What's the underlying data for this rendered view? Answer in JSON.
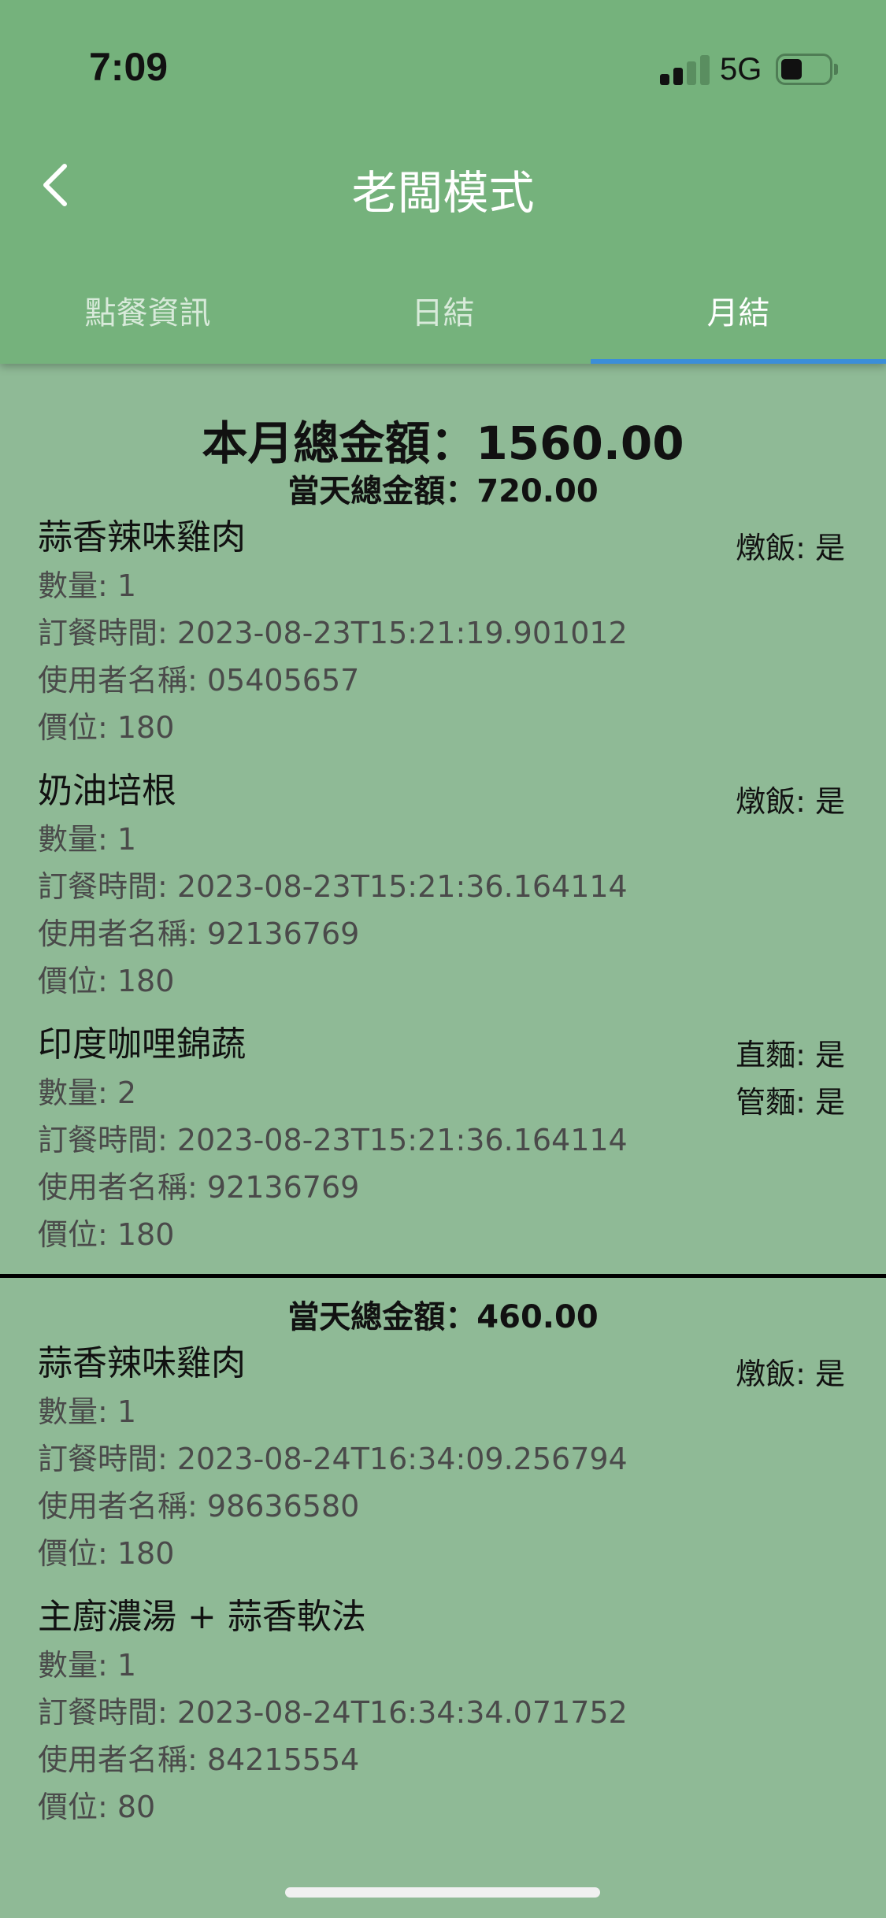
{
  "status_bar": {
    "time": "7:09",
    "network": "5G"
  },
  "header": {
    "title": "老闆模式"
  },
  "tabs": [
    {
      "label": "點餐資訊",
      "active": false
    },
    {
      "label": "日結",
      "active": false
    },
    {
      "label": "月結",
      "active": true
    }
  ],
  "colors": {
    "header_bg": "#75b27c",
    "content_bg": "#8fba96",
    "tab_indicator": "#3b8ed8"
  },
  "month_total": "本月總金額：1560.00",
  "days": [
    {
      "total": "當天總金額：720.00",
      "orders": [
        {
          "name": "蒜香辣味雞肉",
          "qty": "數量: 1",
          "time": "訂餐時間: 2023-08-23T15:21:19.901012",
          "user": "使用者名稱: 05405657",
          "price": "價位: 180",
          "options": [
            "燉飯: 是"
          ]
        },
        {
          "name": "奶油培根",
          "qty": "數量: 1",
          "time": "訂餐時間: 2023-08-23T15:21:36.164114",
          "user": "使用者名稱: 92136769",
          "price": "價位: 180",
          "options": [
            "燉飯: 是"
          ]
        },
        {
          "name": "印度咖哩錦蔬",
          "qty": "數量: 2",
          "time": "訂餐時間: 2023-08-23T15:21:36.164114",
          "user": "使用者名稱: 92136769",
          "price": "價位: 180",
          "options": [
            "直麵: 是",
            "管麵: 是"
          ]
        }
      ]
    },
    {
      "total": "當天總金額：460.00",
      "orders": [
        {
          "name": "蒜香辣味雞肉",
          "qty": "數量: 1",
          "time": "訂餐時間: 2023-08-24T16:34:09.256794",
          "user": "使用者名稱: 98636580",
          "price": "價位: 180",
          "options": [
            "燉飯: 是"
          ]
        },
        {
          "name": "主廚濃湯 + 蒜香軟法",
          "qty": "數量: 1",
          "time": "訂餐時間: 2023-08-24T16:34:34.071752",
          "user": "使用者名稱: 84215554",
          "price": "價位: 80",
          "options": []
        }
      ]
    }
  ]
}
